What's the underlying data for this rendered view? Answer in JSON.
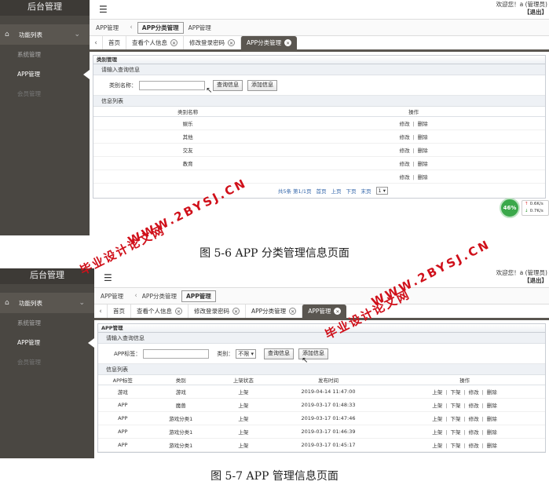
{
  "shared": {
    "brand": "后台管理",
    "menu_head": "功能列表",
    "menu_items": [
      "系统管理",
      "APP管理",
      "会员管理"
    ],
    "welcome": "欢迎您！a (管理员)",
    "logout": "【退出】",
    "home_tab": "首页",
    "tab_profile": "查看个人信息",
    "tab_password": "修改登录密码",
    "tab_category": "APP分类管理",
    "tab_app": "APP管理",
    "search_section": "请输入查询信息",
    "list_section": "信息列表",
    "btn_query": "查询信息",
    "btn_add": "添加信息",
    "op_edit": "修改",
    "op_delete": "删除",
    "op_up": "上架",
    "op_down": "下架",
    "op_sep": "|"
  },
  "shot1": {
    "crumb_app": "APP管理",
    "crumb_box": "APP分类管理",
    "crumb_plain": "APP管理",
    "panel_title": "类别管理",
    "search_label": "类别名称：",
    "col_name": "类别名称",
    "col_ops": "操作",
    "rows": [
      "娱乐",
      "其他",
      "交友",
      "教育",
      ""
    ],
    "pager": {
      "total": "共5条 第1/1页",
      "first": "首页",
      "prev": "上页",
      "next": "下页",
      "last": "末页",
      "page": "1 ▾"
    },
    "caption": "图 5-6  APP 分类管理信息页面"
  },
  "shot2": {
    "crumb_app": "APP管理",
    "crumb_plain": "APP分类管理",
    "crumb_box": "APP管理",
    "panel_title": "APP管理",
    "search_label": "APP标签：",
    "type_label": "类别：",
    "type_value": "不限 ▾",
    "columns": [
      "APP标签",
      "类别",
      "上架状态",
      "发布时间",
      "操作"
    ],
    "rows": [
      {
        "tag": "游戏",
        "type": "游戏",
        "status": "上架",
        "time": "2019-04-14 11:47:00"
      },
      {
        "tag": "APP",
        "type": "魔兽",
        "status": "上架",
        "time": "2019-03-17 01:48:33"
      },
      {
        "tag": "APP",
        "type": "游戏分类1",
        "status": "上架",
        "time": "2019-03-17 01:47:46"
      },
      {
        "tag": "APP",
        "type": "游戏分类1",
        "status": "上架",
        "time": "2019-03-17 01:46:39"
      },
      {
        "tag": "APP",
        "type": "游戏分类1",
        "status": "上架",
        "time": "2019-03-17 01:45:17"
      }
    ],
    "caption": "图 5-7 APP 管理信息页面"
  },
  "watermark": {
    "cn": "毕业设计论文网",
    "url": "WWW.2BYSJ.CN"
  },
  "net_widget": {
    "percent": "46%",
    "up": "0.6K/s",
    "down": "0.7K/s"
  }
}
